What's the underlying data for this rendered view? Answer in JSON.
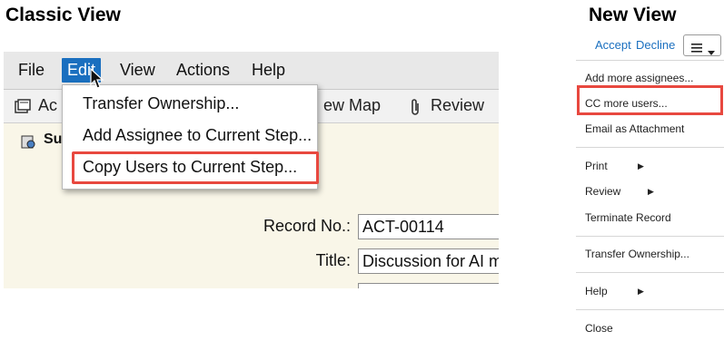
{
  "headings": {
    "classic": "Classic View",
    "new": "New View"
  },
  "classic": {
    "menubar": [
      "File",
      "Edit",
      "View",
      "Actions",
      "Help"
    ],
    "toolbar": {
      "left_partial": "Ac",
      "view_map": "ew Map",
      "review": "Review"
    },
    "section_title_partial": "Su",
    "edit_menu": [
      "Transfer Ownership...",
      "Add Assignee to Current Step...",
      "Copy Users to Current Step..."
    ],
    "form": {
      "record_label": "Record No.:",
      "record_value": "ACT-00114",
      "title_label": "Title:",
      "title_value": "Discussion for AI m"
    }
  },
  "new": {
    "accept": "Accept",
    "decline": "Decline",
    "menu": {
      "add_assignees": "Add more assignees...",
      "cc_users": "CC more users...",
      "email_attachment": "Email as Attachment",
      "print": "Print",
      "review": "Review",
      "terminate": "Terminate Record",
      "transfer": "Transfer Ownership...",
      "help": "Help",
      "close": "Close"
    }
  },
  "colors": {
    "highlight": "#e8483f",
    "accent": "#1a6fbf"
  },
  "icons": [
    "cursor-icon",
    "menu-icon",
    "chevron-down-icon",
    "submenu-arrow-icon",
    "paperclip-icon",
    "form-icon"
  ]
}
